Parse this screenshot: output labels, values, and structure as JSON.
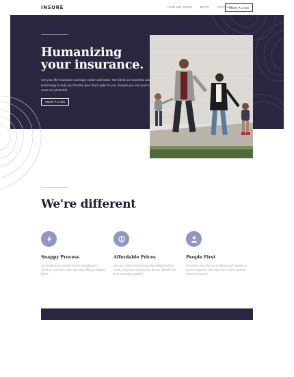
{
  "header": {
    "logo": "INSURE",
    "links": [
      "How we work",
      "Blog",
      "Account"
    ],
    "cta": "View plans"
  },
  "hero": {
    "title_line1": "Humanizing",
    "title_line2": "your insurance.",
    "description": "Get your life insurance coverage easier and faster. We blend our expertise and technology to help you find the plan that's right for you. Ensure you and your loved ones are protected.",
    "button": "View plans"
  },
  "features_section": {
    "title": "We're different",
    "items": [
      {
        "icon": "snappy-icon",
        "title": "Snappy Process",
        "text": "Our application process can be completed in minutes, not hours. Don't get stuck filling in tedious forms."
      },
      {
        "icon": "price-icon",
        "title": "Affordable Prices",
        "text": "We don't want you worrying about high monthly costs. Our prices may be low, but we still offer the best coverage possible."
      },
      {
        "icon": "people-icon",
        "title": "People First",
        "text": "Our plans aren't full of conditions and clauses to prevent payouts. We make sure you're covered when you need it."
      }
    ]
  },
  "colors": {
    "dark": "#2b263f",
    "accent": "#8f96c0"
  }
}
